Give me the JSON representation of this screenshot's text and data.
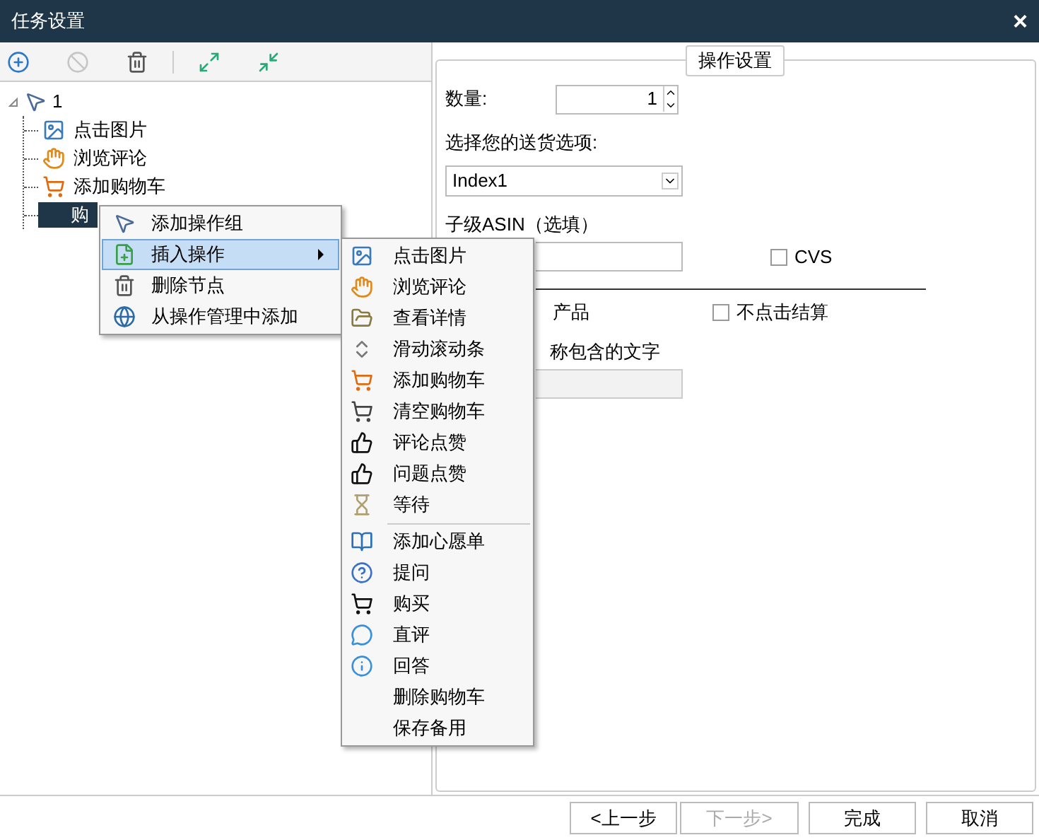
{
  "window": {
    "title": "任务设置",
    "close": "×"
  },
  "toolbar": [
    {
      "kind": "add",
      "disabled": false
    },
    {
      "kind": "ban",
      "disabled": true
    },
    {
      "kind": "delete",
      "disabled": false
    },
    {
      "kind": "expand",
      "disabled": false
    },
    {
      "kind": "collapse",
      "disabled": false
    }
  ],
  "tree": {
    "label": "1",
    "kind": "pointer",
    "expanded": true,
    "children": [
      {
        "label": "点击图片",
        "kind": "image",
        "selected": false
      },
      {
        "label": "浏览评论",
        "kind": "hand",
        "selected": false
      },
      {
        "label": "添加购物车",
        "kind": "cart",
        "selected": false
      },
      {
        "label": "购",
        "kind": "none",
        "selected": true
      }
    ]
  },
  "settings": {
    "legend": "操作设置",
    "quantity_label": "数量:",
    "quantity_value": "1",
    "shipping_label": "选择您的送货选项:",
    "shipping_value": "Index1",
    "asin_label": "子级ASIN（选填）",
    "cvs": {
      "label": "CVS",
      "checked": false
    },
    "product_label": "产品",
    "no_checkout": {
      "label": "不点击结算",
      "checked": false
    },
    "name_text_label": "称包含的文字"
  },
  "context_menu": [
    {
      "label": "添加操作组",
      "kind": "pointer",
      "selected": false,
      "submenu": false
    },
    {
      "label": "插入操作",
      "kind": "insert",
      "selected": true,
      "submenu": true
    },
    {
      "label": "删除节点",
      "kind": "trash",
      "selected": false,
      "submenu": false
    },
    {
      "label": "从操作管理中添加",
      "kind": "globe",
      "selected": false,
      "submenu": false
    }
  ],
  "submenu": [
    {
      "label": "点击图片",
      "kind": "image",
      "separator_before": false
    },
    {
      "label": "浏览评论",
      "kind": "hand",
      "separator_before": false
    },
    {
      "label": "查看详情",
      "kind": "folder",
      "separator_before": false
    },
    {
      "label": "滑动滚动条",
      "kind": "scroll",
      "separator_before": false
    },
    {
      "label": "添加购物车",
      "kind": "cart",
      "separator_before": false
    },
    {
      "label": "清空购物车",
      "kind": "empty-cart",
      "separator_before": false
    },
    {
      "label": "评论点赞",
      "kind": "thumb",
      "separator_before": false
    },
    {
      "label": "问题点赞",
      "kind": "thumb",
      "separator_before": false
    },
    {
      "label": "等待",
      "kind": "hourglass",
      "separator_before": false
    },
    {
      "label": "添加心愿单",
      "kind": "book",
      "separator_before": true
    },
    {
      "label": "提问",
      "kind": "question",
      "separator_before": false
    },
    {
      "label": "购买",
      "kind": "buy",
      "separator_before": false
    },
    {
      "label": "直评",
      "kind": "chat",
      "separator_before": false
    },
    {
      "label": "回答",
      "kind": "answer",
      "separator_before": false
    },
    {
      "label": "删除购物车",
      "kind": "none",
      "separator_before": false
    },
    {
      "label": "保存备用",
      "kind": "none",
      "separator_before": false
    }
  ],
  "footer": [
    {
      "label": "<上一步",
      "disabled": false
    },
    {
      "label": "下一步>",
      "disabled": true
    },
    {
      "label": "完成",
      "disabled": false
    },
    {
      "label": "取消",
      "disabled": false
    }
  ]
}
